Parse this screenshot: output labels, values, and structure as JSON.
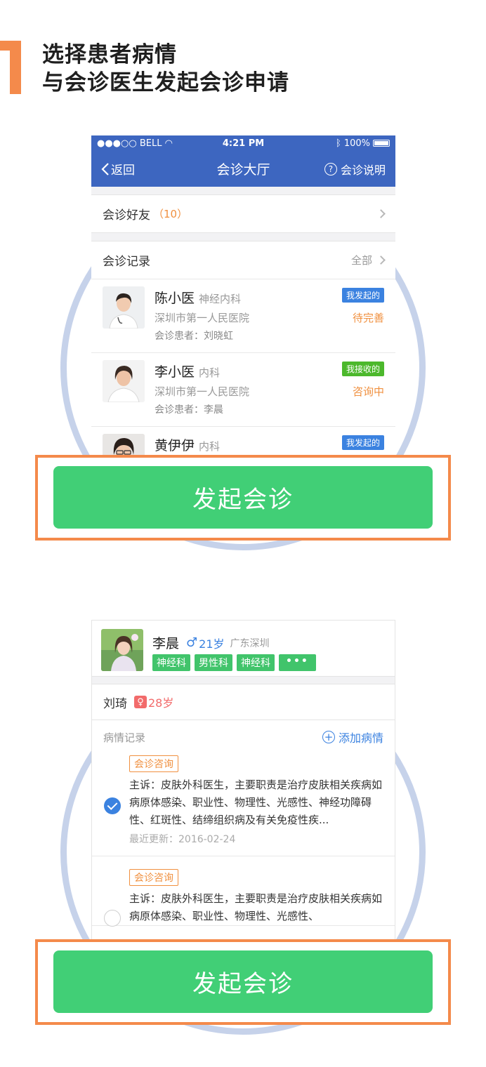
{
  "header": {
    "step_number": "1",
    "title_line1": "选择患者病情",
    "title_line2": "与会诊医生发起会诊申请"
  },
  "phone1": {
    "status": {
      "carrier": "●●●○○ BELL",
      "time": "4:21 PM",
      "battery": "100%"
    },
    "nav": {
      "back": "返回",
      "title": "会诊大厅",
      "help": "会诊说明"
    },
    "friends": {
      "label": "会诊好友",
      "count": "（10）"
    },
    "records_header": {
      "label": "会诊记录",
      "all": "全部"
    },
    "records": [
      {
        "name": "陈小医",
        "dept": "神经内科",
        "hospital": "深圳市第一人民医院",
        "patient": "会诊患者：刘晓虹",
        "badge": "我发起的",
        "status": "待完善"
      },
      {
        "name": "李小医",
        "dept": "内科",
        "hospital": "深圳市第一人民医院",
        "patient": "会诊患者：李晨",
        "badge": "我接收的",
        "status": "咨询中"
      },
      {
        "name": "黄伊伊",
        "dept": "内科",
        "badge": "我发起的"
      }
    ]
  },
  "button1": {
    "label": "发起会诊"
  },
  "phone2": {
    "patient": {
      "name": "李晨",
      "gender_icon": "♂",
      "age": "21岁",
      "location": "广东深圳",
      "tags": [
        "神经科",
        "男性科",
        "神经科",
        "•••"
      ]
    },
    "member": {
      "name": "刘琦",
      "gender_icon": "♀",
      "age": "28岁"
    },
    "conditions_header": {
      "label": "病情记录",
      "add": "添加病情",
      "add_icon": "+"
    },
    "conditions": [
      {
        "tag": "会诊咨询",
        "text": "主诉：皮肤外科医生，主要职责是治疗皮肤相关疾病如病原体感染、职业性、物理性、光感性、神经功障碍性、红斑性、结缔组织病及有关免疫性疾...",
        "updated": "最近更新：2016-02-24",
        "checked": true
      },
      {
        "tag": "会诊咨询",
        "text": "主诉：皮肤外科医生，主要职责是治疗皮肤相关疾病如病原体感染、职业性、物理性、光感性、",
        "checked": false
      }
    ]
  },
  "button2": {
    "label": "发起会诊"
  },
  "colors": {
    "accent_orange": "#f48a4b",
    "nav_blue": "#3d66c0",
    "button_green": "#41cf76",
    "circle": "#c6d2ea"
  }
}
